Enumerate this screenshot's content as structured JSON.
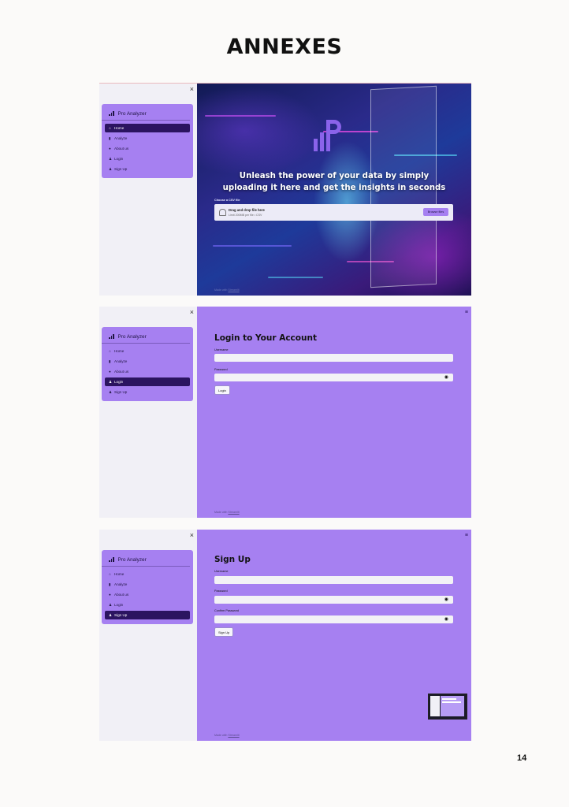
{
  "document": {
    "title": "ANNEXES",
    "page_number": "14"
  },
  "sidebar": {
    "close": "×",
    "brand": "Pro Analyzer",
    "items": [
      {
        "label": "Home",
        "icon": "home-icon"
      },
      {
        "label": "Analyze",
        "icon": "bar-chart-icon"
      },
      {
        "label": "About us",
        "icon": "info-icon"
      },
      {
        "label": "Login",
        "icon": "user-icon"
      },
      {
        "label": "Sign Up",
        "icon": "user-plus-icon"
      }
    ]
  },
  "home": {
    "headline": "Unleash the power of your data by simply uploading it here and get the insights in seconds",
    "upload_label": "Choose a CSV file",
    "drop_text": "Drag and drop file here",
    "limit_text": "Limit 200MB per file • CSV",
    "browse_label": "Browse files"
  },
  "login": {
    "title": "Login to Your Account",
    "username_label": "Username",
    "password_label": "Password",
    "submit": "Login"
  },
  "signup": {
    "title": "Sign Up",
    "username_label": "Username",
    "password_label": "Password",
    "confirm_label": "Confirm Password",
    "submit": "Sign Up"
  },
  "footer": {
    "prefix": "Made with",
    "brand": "Streamlit"
  },
  "colors": {
    "accent": "#a680f1",
    "active": "#2b1460",
    "sidebar": "#f1f0f6"
  }
}
